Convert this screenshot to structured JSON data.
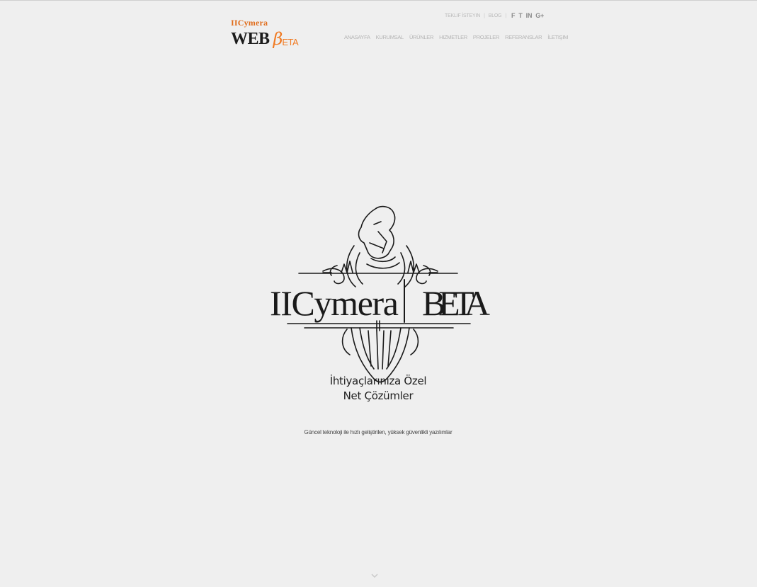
{
  "brand": {
    "top_name": "IICymera",
    "web": "WEB",
    "beta_symbol": "β",
    "beta_rest": "ETA"
  },
  "utility": {
    "quote_link": "Teklif İsteyin",
    "blog_link": "Blog",
    "social_icons": [
      "facebook-icon",
      "twitter-icon",
      "linkedin-icon",
      "google-plus-icon"
    ],
    "social_glyphs": [
      "f",
      "t",
      "in",
      "g+"
    ]
  },
  "nav": {
    "items": [
      "Anasayfa",
      "Kurumsal",
      "Ürünler",
      "Hizmetler",
      "Projeler",
      "Referanslar",
      "İletişim"
    ]
  },
  "hero": {
    "emblem_left": "IICymera",
    "emblem_right": "BETA",
    "title_line1": "İhtiyaçlarınıza Özel",
    "title_line2": "Net Çözümler",
    "subtitle": "Güncel teknoloji ile hızlı geliştirilen, yüksek güvenlikli yazılımlar"
  },
  "colors": {
    "background": "#efefef",
    "accent": "#f07a22",
    "text_dark": "#1f1f1f",
    "nav_text": "#b4b4b4"
  }
}
